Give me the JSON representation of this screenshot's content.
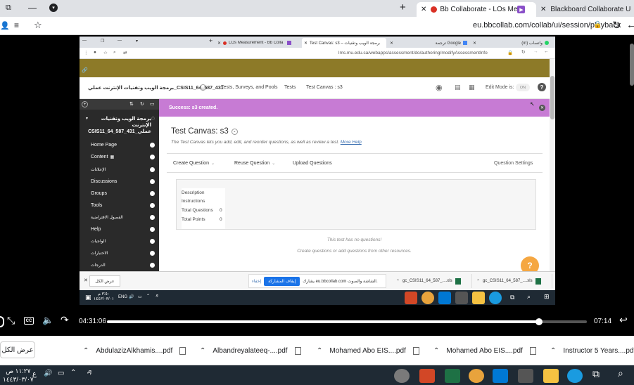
{
  "outer_browser": {
    "tabs": [
      {
        "label": "Bb Collaborate - LOs Measure"
      },
      {
        "label": "Blackboard Collaborate Ultra - "
      }
    ],
    "address": "eu.bbcollab.com/collab/ui/session/playback"
  },
  "inner_browser": {
    "tabs": [
      {
        "label": "LOs Measurement - Bb Colla"
      },
      {
        "label": "Test Canvas: s3 – برمجة الويب وتقنيات"
      },
      {
        "label": "ترجمة Google"
      },
      {
        "label": "(m) واتساب"
      }
    ],
    "address": "lms.mu.edu.sa/webapps/assessment/do/authoring/modifyAssessmentInfo"
  },
  "bb_header": {
    "course_name": "برمجة الويب وتقنيات الإنترنت عملي_CSIS11_64_587_431",
    "breadcrumb": [
      "Tests, Surveys, and Pools",
      "Tests",
      "Test Canvas : s3"
    ],
    "edit_mode_label": "Edit Mode is:",
    "edit_mode_value": "ON"
  },
  "sidebar": {
    "course_title": "برمجة الويب وتقنيات الإنترنت عملي_CSIS11_64_587_431",
    "items": [
      {
        "label": "Home Page"
      },
      {
        "label": "Content"
      },
      {
        "label": "الإعلانات"
      },
      {
        "label": "Discussions"
      },
      {
        "label": "Groups"
      },
      {
        "label": "Tools"
      },
      {
        "label": "الفصول الافتراضية"
      },
      {
        "label": "Help"
      },
      {
        "label": "الواجبات"
      },
      {
        "label": "الاختبارات"
      },
      {
        "label": "الدرجات"
      }
    ]
  },
  "main": {
    "success_message": "Success: s3 created.",
    "page_title": "Test Canvas: s3",
    "description": "The Test Canvas lets you add, edit, and reorder questions, as well as review a test.",
    "more_help": "More Help",
    "toolbar": {
      "create_question": "Create Question",
      "reuse_question": "Reuse Question",
      "upload_questions": "Upload Questions",
      "question_settings": "Question Settings"
    },
    "info": {
      "description_label": "Description",
      "instructions_label": "Instructions",
      "total_questions_label": "Total Questions",
      "total_questions_value": "0",
      "total_points_label": "Total Points",
      "total_points_value": "0"
    },
    "empty_title": "This test has no questions!",
    "empty_hint": "Create questions or add questions from other resources."
  },
  "inner_downloads": {
    "show_all": "عرض الكل",
    "share_text": "يشارك eu.bbcollab.com الشاشة والصوت.",
    "stop_share": "إيقاف المشاركة",
    "hide": "إخفاء",
    "files": [
      {
        "name": "gc_CSIS11_64_587_....xls"
      },
      {
        "name": "gc_CSIS11_64_587_....xls"
      }
    ]
  },
  "inner_taskbar": {
    "lang": "ENG",
    "time": "٣:٥٠ م",
    "date": "١٤٤٣/٠٣/٠١"
  },
  "video_controls": {
    "current_time": "04:31:06",
    "end_time": "07:14",
    "progress_percent": 90
  },
  "outer_downloads": {
    "show_all": "عرض الكل",
    "files": [
      {
        "name": "AbdulazizAlkhamis....pdf"
      },
      {
        "name": "Albandreyalateeq-....pdf"
      },
      {
        "name": "Mohamed Abo EIS....pdf"
      },
      {
        "name": "Mohamed Abo EIS....pdf"
      },
      {
        "name": "Instructor 5 Years....pdf"
      }
    ]
  },
  "outer_taskbar": {
    "time": "١١:٢٧ ص",
    "date": "١٤٤٣/٠٣/٠٧",
    "lang": "ع"
  },
  "colors": {
    "success_bg": "#c77bd4",
    "olive_header": "#8d7a28",
    "sidebar_bg": "#2a2a2a",
    "link_blue": "#3a6fb0",
    "help_orange": "#f5a742",
    "share_btn": "#1a73e8"
  }
}
